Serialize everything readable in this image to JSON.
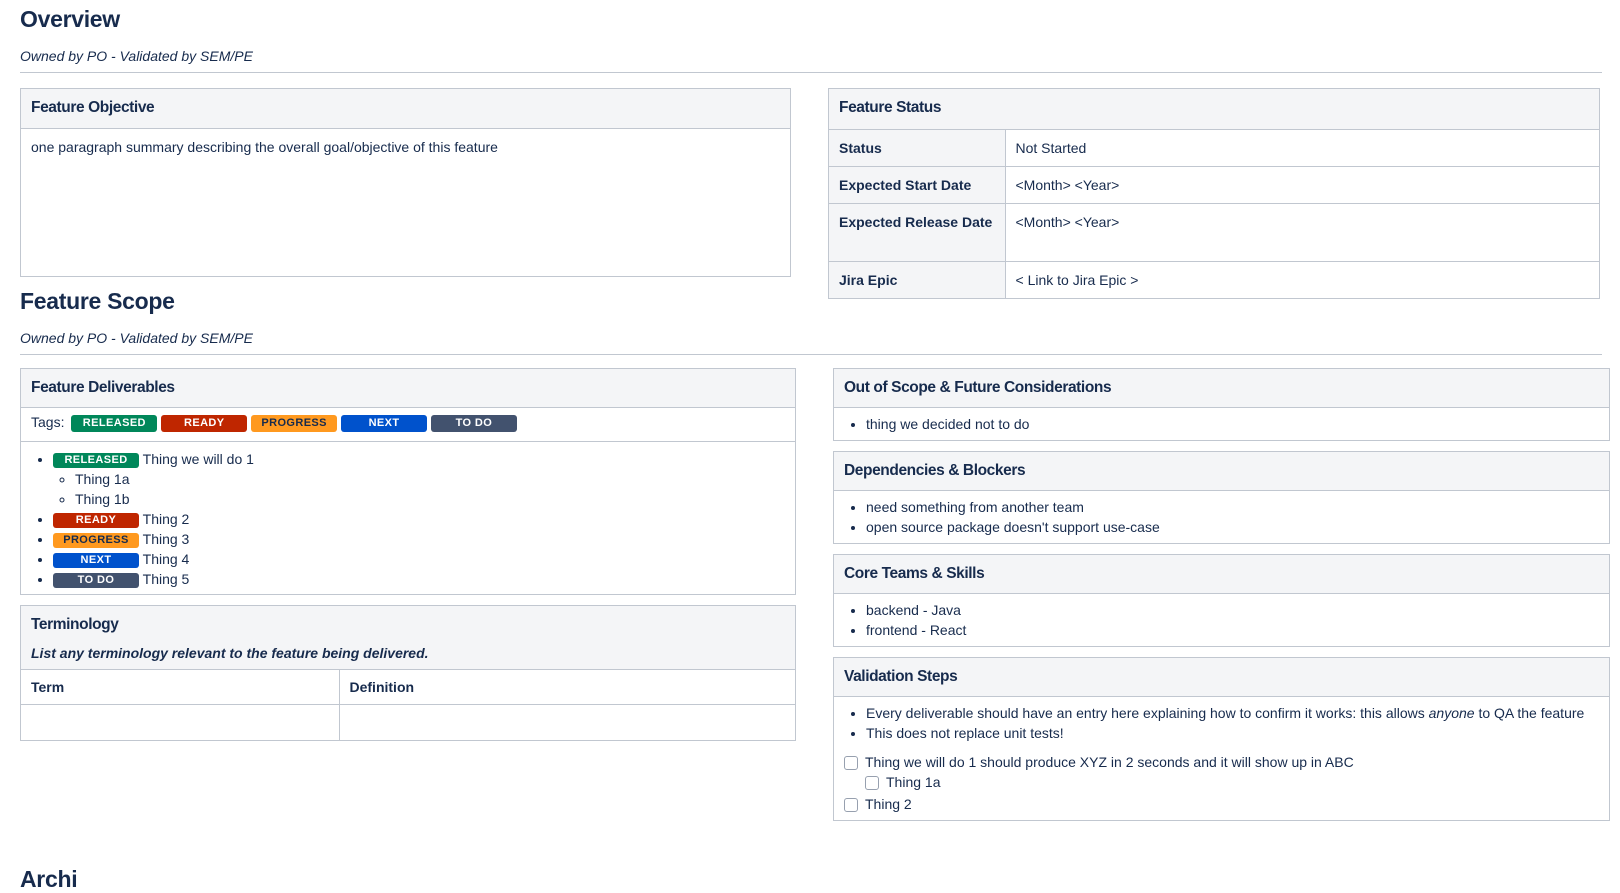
{
  "overview": {
    "title": "Overview",
    "owned": "Owned by PO - Validated by SEM/PE",
    "objective": {
      "title": "Feature Objective",
      "text": "one paragraph summary describing the overall goal/objective of this feature"
    },
    "status": {
      "title": "Feature Status",
      "rows": [
        {
          "key": "Status",
          "value": "Not Started"
        },
        {
          "key": "Expected Start Date",
          "value": "<Month> <Year>"
        },
        {
          "key": "Expected Release Date",
          "value": "<Month> <Year>"
        },
        {
          "key": "Jira Epic",
          "value": "< Link to Jira Epic >"
        }
      ]
    }
  },
  "scope": {
    "title": "Feature Scope",
    "owned": "Owned by PO - Validated by SEM/PE",
    "deliverables": {
      "title": "Feature Deliverables",
      "tags_label": "Tags:",
      "tags": [
        {
          "label": "RELEASED",
          "color": "#00875a"
        },
        {
          "label": "READY",
          "color": "#bf2600"
        },
        {
          "label": "PROGRESS",
          "color": "#ff991f"
        },
        {
          "label": "NEXT",
          "color": "#0052cc"
        },
        {
          "label": "TO DO",
          "color": "#42526e"
        }
      ],
      "items": [
        {
          "tag": "RELEASED",
          "text": "Thing we will do 1",
          "sub": [
            "Thing 1a",
            "Thing 1b"
          ]
        },
        {
          "tag": "READY",
          "text": "Thing 2"
        },
        {
          "tag": "PROGRESS",
          "text": "Thing 3"
        },
        {
          "tag": "NEXT",
          "text": "Thing 4"
        },
        {
          "tag": "TO DO",
          "text": "Thing 5"
        }
      ]
    },
    "terminology": {
      "title": "Terminology",
      "subtitle": "List any terminology relevant to the feature being delivered.",
      "headers": [
        "Term",
        "Definition"
      ],
      "rows": [
        [
          "",
          ""
        ]
      ]
    },
    "out_of_scope": {
      "title": "Out of Scope & Future Considerations",
      "items": [
        "thing we decided not to do"
      ]
    },
    "dependencies": {
      "title": "Dependencies & Blockers",
      "items": [
        "need something from another team",
        "open source package doesn't support use-case"
      ]
    },
    "core_teams": {
      "title": "Core Teams & Skills",
      "items": [
        "backend - Java",
        "frontend - React"
      ]
    },
    "validation": {
      "title": "Validation Steps",
      "bullet1_pre": "Every deliverable should have an entry here explaining how to confirm it works: this allows ",
      "bullet1_em": "anyone",
      "bullet1_post": " to QA the feature",
      "bullet2": "This does not replace unit tests!",
      "tasks": [
        {
          "text": "Thing we will do 1 should produce XYZ in 2 seconds and it will show up in ABC",
          "checked": false
        },
        {
          "text": "Thing 1a",
          "checked": false,
          "nested": true
        },
        {
          "text": "Thing 2",
          "checked": false
        }
      ]
    }
  },
  "next_section_title": "Archi"
}
